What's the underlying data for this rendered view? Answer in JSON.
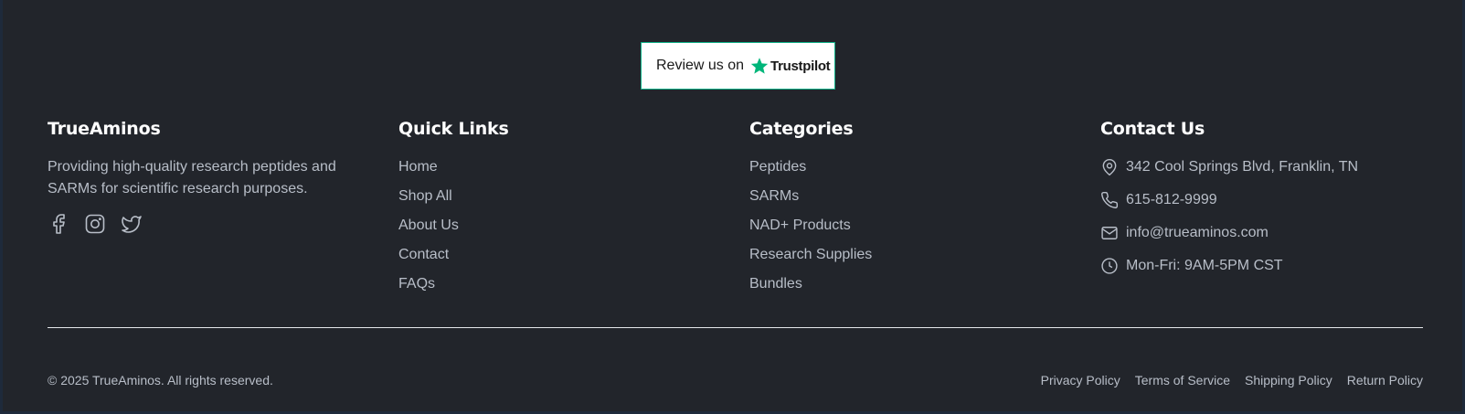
{
  "trustpilot": {
    "prefix": "Review us on",
    "brand": "Trustpilot",
    "star_color": "#00b67a"
  },
  "brand": {
    "name": "TrueAminos",
    "description": "Providing high-quality research peptides and SARMs for scientific research purposes.",
    "social_icons": [
      "facebook-icon",
      "instagram-icon",
      "twitter-icon"
    ]
  },
  "quick_links": {
    "title": "Quick Links",
    "items": [
      "Home",
      "Shop All",
      "About Us",
      "Contact",
      "FAQs"
    ]
  },
  "categories": {
    "title": "Categories",
    "items": [
      "Peptides",
      "SARMs",
      "NAD+ Products",
      "Research Supplies",
      "Bundles"
    ]
  },
  "contact": {
    "title": "Contact Us",
    "address": "342 Cool Springs Blvd, Franklin, TN",
    "phone": "615-812-9999",
    "email": "info@trueaminos.com",
    "hours": "Mon-Fri: 9AM-5PM CST"
  },
  "bottom": {
    "copyright": "© 2025 TrueAminos. All rights reserved.",
    "legal": [
      "Privacy Policy",
      "Terms of Service",
      "Shipping Policy",
      "Return Policy"
    ]
  },
  "colors": {
    "background": "#22252b",
    "heading": "#ffffff",
    "text": "#b8bec8",
    "accent": "#0fb087"
  }
}
